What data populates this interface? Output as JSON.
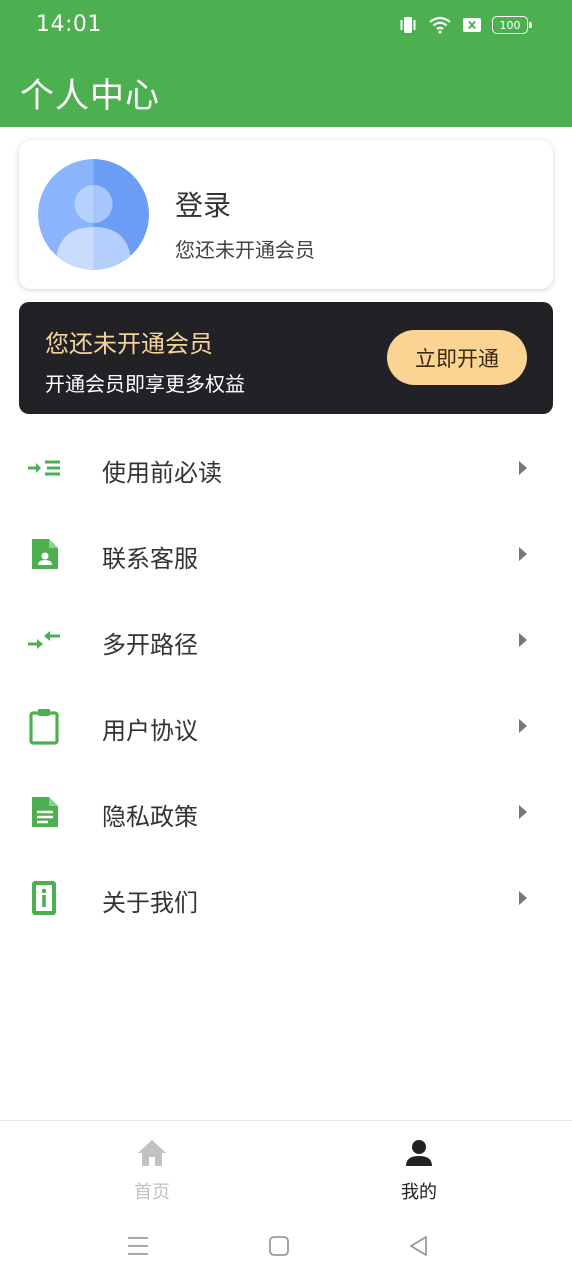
{
  "status_bar": {
    "time": "14:01",
    "battery": "100",
    "icons": [
      "vibrate-icon",
      "wifi-icon",
      "sim-off-icon",
      "battery-icon"
    ]
  },
  "header": {
    "title": "个人中心"
  },
  "profile": {
    "login_label": "登录",
    "member_status": "您还未开通会员",
    "avatar_color": "#7aa7f7"
  },
  "vip": {
    "title": "您还未开通会员",
    "subtitle": "开通会员即享更多权益",
    "button_label": "立即开通",
    "title_color": "#f3d49b",
    "button_color": "#fbd392"
  },
  "menu": {
    "items": [
      {
        "label": "使用前必读",
        "icon": "read-first-icon"
      },
      {
        "label": "联系客服",
        "icon": "contact-card-icon"
      },
      {
        "label": "多开路径",
        "icon": "swap-arrows-icon"
      },
      {
        "label": "用户协议",
        "icon": "clipboard-icon"
      },
      {
        "label": "隐私政策",
        "icon": "document-icon"
      },
      {
        "label": "关于我们",
        "icon": "info-icon"
      }
    ],
    "icon_color": "#4caf50"
  },
  "bottom_nav": {
    "tabs": [
      {
        "label": "首页",
        "icon": "home-icon",
        "active": false
      },
      {
        "label": "我的",
        "icon": "person-icon",
        "active": true
      }
    ]
  },
  "theme": {
    "primary": "#4caf50"
  }
}
